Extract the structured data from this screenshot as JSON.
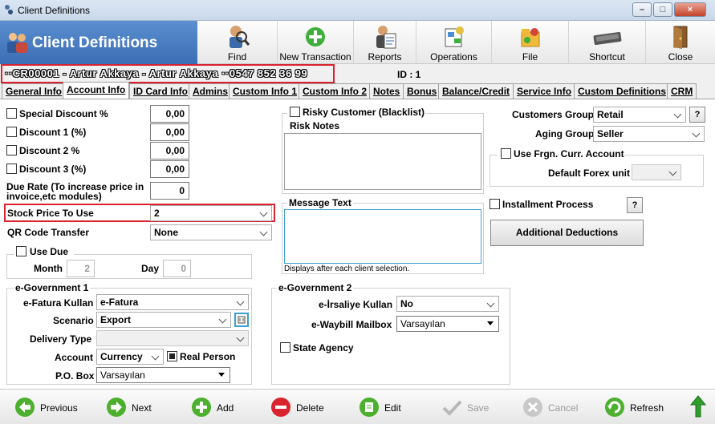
{
  "window": {
    "title": "Client Definitions",
    "minimize": "–",
    "maximize": "□",
    "close": "×"
  },
  "banner": {
    "title": "Client Definitions"
  },
  "toolbar": {
    "find": "Find",
    "new_transaction": "New Transaction",
    "reports": "Reports",
    "operations": "Operations",
    "file": "File",
    "shortcut": "Shortcut",
    "close": "Close"
  },
  "client": {
    "summary": "··CR00001 - Artur Akkaya - Artur Akkaya ··0547 852 36 99",
    "id_label": "ID : 1"
  },
  "tabs": [
    "General Info",
    "Account Info",
    "ID Card Info",
    "Admins",
    "Custom Info 1",
    "Custom Info 2",
    "Notes",
    "Bonus",
    "Balance/Credit",
    "Service Info",
    "Custom Definitions",
    "CRM"
  ],
  "left": {
    "special_discount": {
      "label": "Special Discount %",
      "value": "0,00"
    },
    "discount1": {
      "label": "Discount 1 (%)",
      "value": "0,00"
    },
    "discount2": {
      "label": "Discount 2 %",
      "value": "0,00"
    },
    "discount3": {
      "label": "Discount 3 (%)",
      "value": "0,00"
    },
    "due_rate": {
      "label": "Due Rate (To increase price in invoice,etc modules)",
      "value": "0"
    },
    "stock_price": {
      "label": "Stock Price To Use",
      "value": "2"
    },
    "qr_code": {
      "label": "QR Code Transfer",
      "value": "None"
    },
    "use_due": {
      "label": "Use Due",
      "month_label": "Month",
      "month_value": "2",
      "day_label": "Day",
      "day_value": "0"
    }
  },
  "middle": {
    "risky": {
      "label": "Risky Customer (Blacklist)"
    },
    "risk_notes_label": "Risk Notes",
    "message_text_label": "Message Text",
    "message_hint": "Displays after each client selection."
  },
  "right": {
    "customers_group": {
      "label": "Customers Group",
      "value": "Retail",
      "help": "?"
    },
    "aging_group": {
      "label": "Aging Group",
      "value": "Seller"
    },
    "frgn_account": {
      "label": "Use Frgn. Curr. Account"
    },
    "default_forex": {
      "label": "Default Forex unit",
      "value": ""
    },
    "installment": {
      "label": "Installment Process",
      "help": "?"
    },
    "additional_deductions": "Additional Deductions"
  },
  "egov1": {
    "title": "e-Government 1",
    "efatura": {
      "label": "e-Fatura Kullan",
      "value": "e-Fatura"
    },
    "scenario": {
      "label": "Scenario",
      "value": "Export"
    },
    "delivery": {
      "label": "Delivery Type",
      "value": ""
    },
    "account": {
      "label": "Account",
      "value": "Currency"
    },
    "real_person": "Real Person",
    "po_box": {
      "label": "P.O. Box",
      "value": "Varsayılan"
    }
  },
  "egov2": {
    "title": "e-Government 2",
    "eirsaliye": {
      "label": "e-İrsaliye Kullan",
      "value": "No"
    },
    "ewaybill": {
      "label": "e-Waybill Mailbox",
      "value": "Varsayılan"
    },
    "state_agency": "State Agency"
  },
  "bottom": {
    "previous": "Previous",
    "next": "Next",
    "add": "Add",
    "delete": "Delete",
    "edit": "Edit",
    "save": "Save",
    "cancel": "Cancel",
    "refresh": "Refresh"
  }
}
